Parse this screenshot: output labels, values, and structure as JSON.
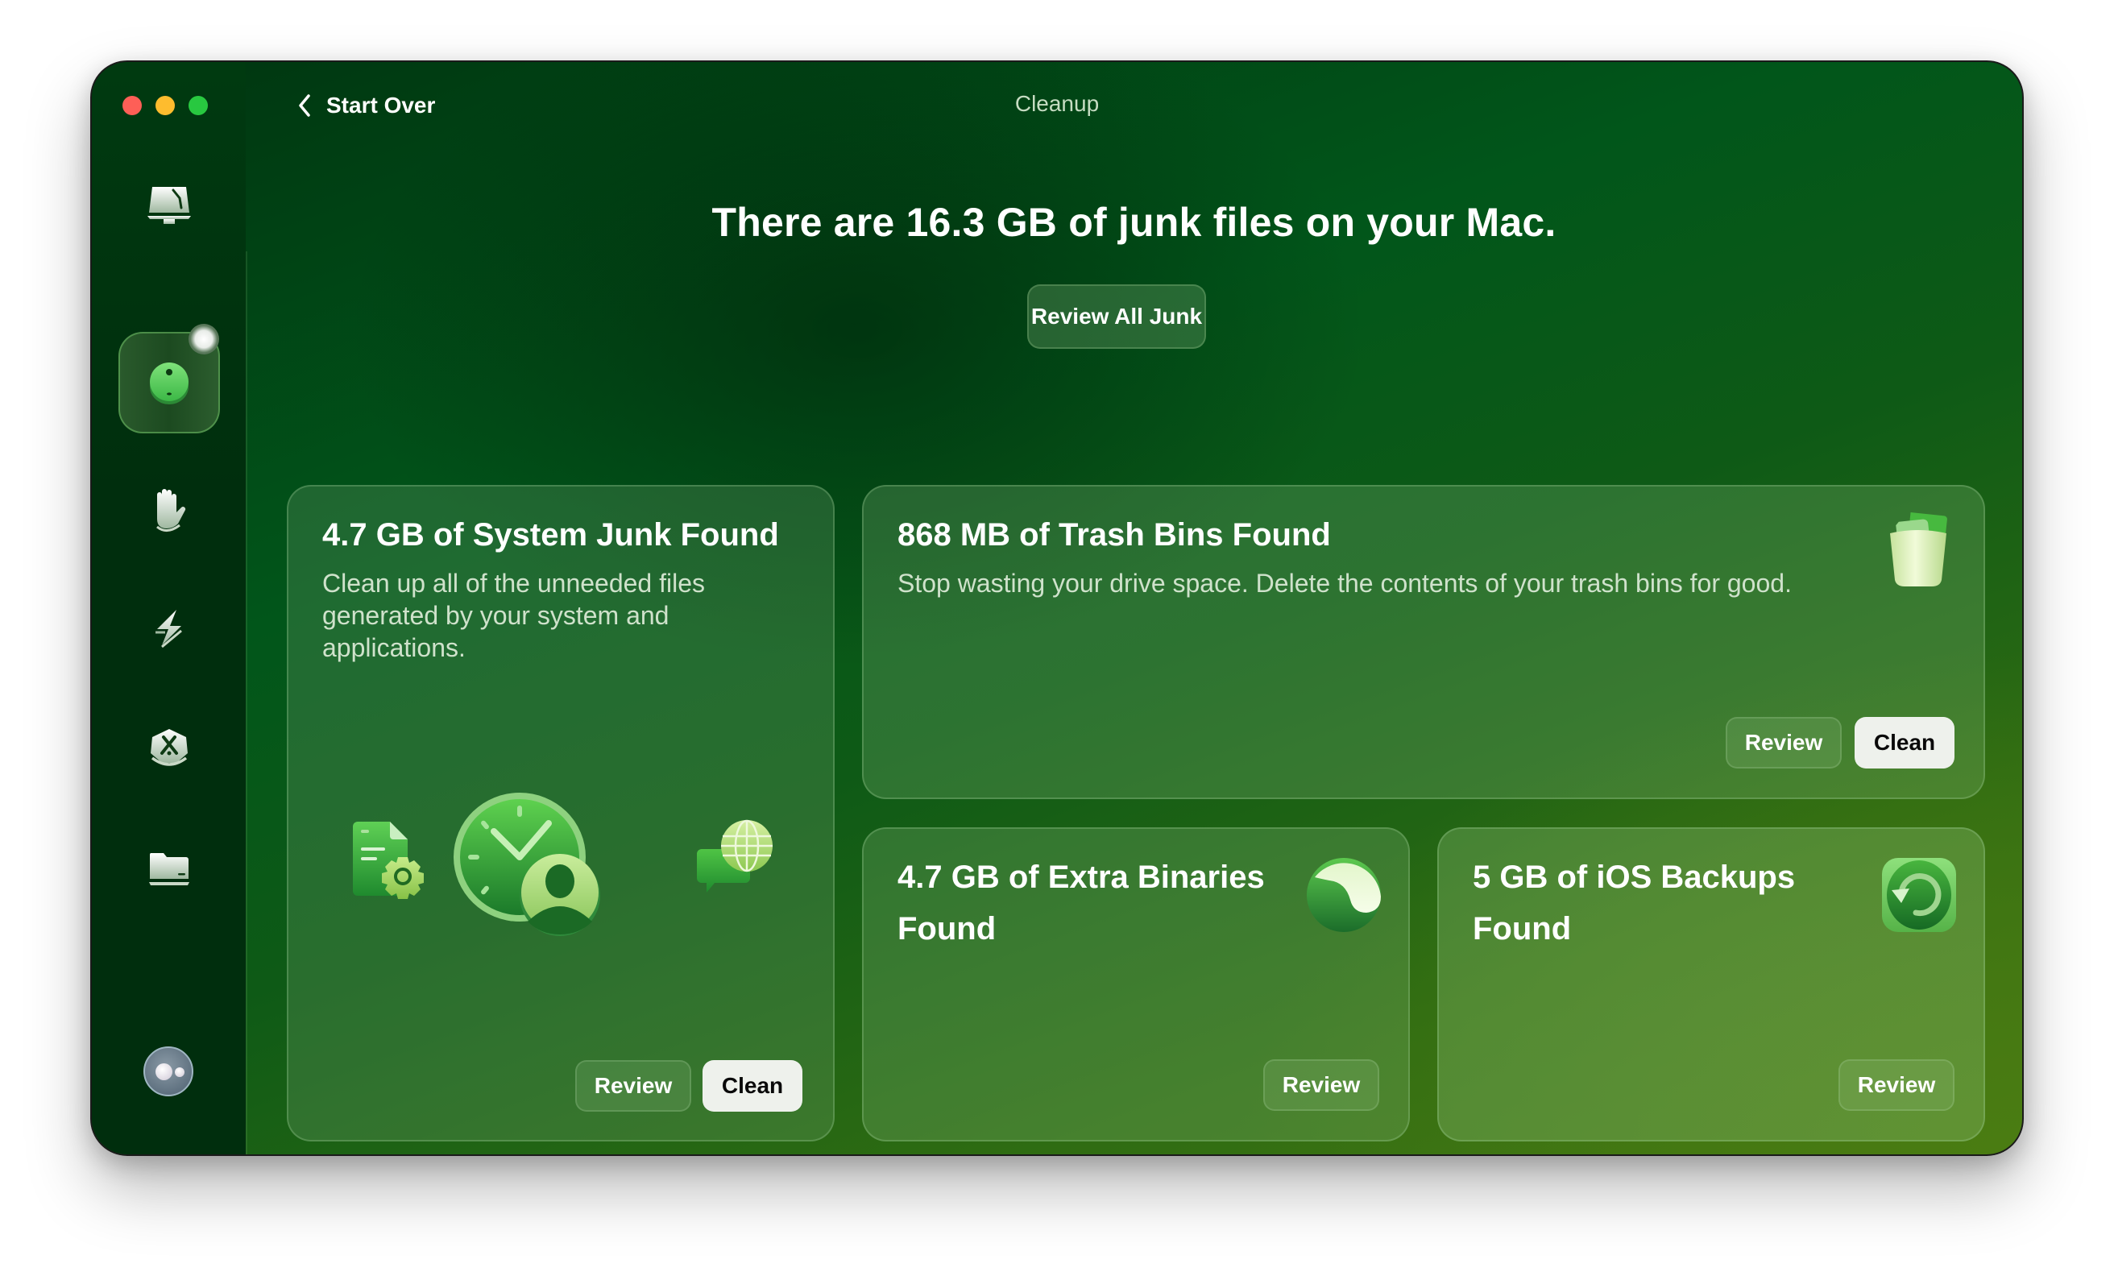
{
  "window": {
    "title": "Cleanup",
    "traffic_lights": [
      "close",
      "minimize",
      "maximize"
    ],
    "back_button": {
      "icon": "chevron-left-icon",
      "label": "Start Over"
    }
  },
  "sidebar": {
    "items": [
      {
        "name": "smart-care",
        "icon": "monitor-broom-icon",
        "selected": false
      },
      {
        "name": "cleanup",
        "icon": "cleanup-disc-icon",
        "selected": true,
        "has_badge": true
      },
      {
        "name": "protection",
        "icon": "hand-icon",
        "selected": false
      },
      {
        "name": "performance",
        "icon": "lightning-icon",
        "selected": false
      },
      {
        "name": "applications",
        "icon": "apps-icon",
        "selected": false
      },
      {
        "name": "my-clutter",
        "icon": "folder-icon",
        "selected": false
      }
    ],
    "assistant": {
      "icon": "assistant-icon"
    }
  },
  "main": {
    "headline": "There are 16.3 GB of junk files on your Mac.",
    "review_all_label": "Review All Junk",
    "cards": [
      {
        "title": "4.7 GB of System Junk Found",
        "description": "Clean up all of the unneeded files generated by your system and applications.",
        "icons": [
          "document-gear-icon",
          "clock-user-icon",
          "chat-globe-icon"
        ],
        "review_label": "Review",
        "clean_label": "Clean"
      },
      {
        "title": "868 MB of Trash Bins Found",
        "description": "Stop wasting your drive space. Delete the contents of your trash bins for good.",
        "icon": "trash-bin-icon",
        "review_label": "Review",
        "clean_label": "Clean"
      },
      {
        "title": "4.7 GB of Extra Binaries Found",
        "icon": "yin-yang-icon",
        "review_label": "Review"
      },
      {
        "title": "5 GB of iOS Backups Found",
        "icon": "backup-restore-icon",
        "review_label": "Review"
      }
    ]
  },
  "colors": {
    "accent_green": "#28c840",
    "close": "#fe5f57",
    "minimize": "#febc2e",
    "maximize": "#28c840",
    "clean_button_bg": "#eef1ec"
  }
}
